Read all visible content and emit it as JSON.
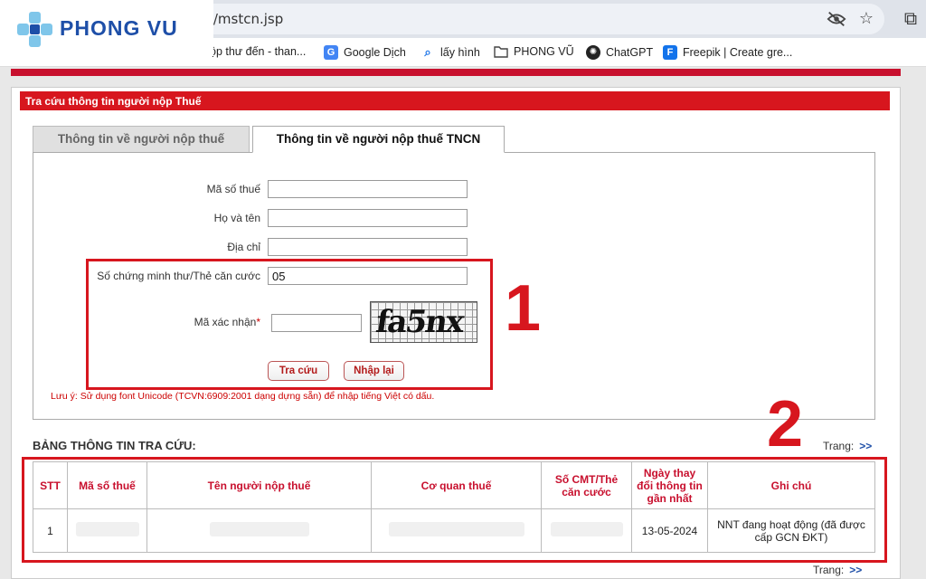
{
  "browser": {
    "url": "t/mstcn.jsp",
    "bookmarks": [
      {
        "label": "ộp thư đến - than...",
        "icon": "mail-icon"
      },
      {
        "label": "Google Dịch",
        "icon": "translate-icon"
      },
      {
        "label": "lấy hình",
        "icon": "search-icon"
      },
      {
        "label": "PHONG VŨ",
        "icon": "folder-icon"
      },
      {
        "label": "ChatGPT",
        "icon": "chatgpt-icon"
      },
      {
        "label": "Freepik | Create gre...",
        "icon": "freepik-icon"
      }
    ]
  },
  "logo": {
    "text": "PHONG VU"
  },
  "panel": {
    "header": "Tra cứu thông tin người nộp Thuế"
  },
  "tabs": [
    {
      "label": "Thông tin về người nộp thuế",
      "active": false
    },
    {
      "label": "Thông tin về người nộp thuế TNCN",
      "active": true
    }
  ],
  "form": {
    "tax_code_label": "Mã số thuế",
    "tax_code_value": "",
    "name_label": "Họ và tên",
    "name_value": "",
    "address_label": "Địa chỉ",
    "address_value": "",
    "id_label": "Số chứng minh thư/Thẻ căn cước",
    "id_value": "05",
    "captcha_label": "Mã xác nhận",
    "captcha_required_mark": "*",
    "captcha_value": "",
    "captcha_image_text": "fa5nx",
    "search_button": "Tra cứu",
    "reset_button": "Nhập lại",
    "note": "Lưu ý: Sử dụng font Unicode (TCVN:6909:2001 dạng dựng sẵn) để nhập tiếng Việt có dấu."
  },
  "annotations": {
    "one": "1",
    "two": "2"
  },
  "results": {
    "title": "BẢNG THÔNG TIN TRA CỨU:",
    "pager_label": "Trang:",
    "pager_arrow": ">>",
    "columns": [
      "STT",
      "Mã số thuế",
      "Tên người nộp thuế",
      "Cơ quan thuế",
      "Số CMT/Thẻ căn cước",
      "Ngày thay đổi thông tin gần nhất",
      "Ghi chú"
    ],
    "rows": [
      {
        "stt": "1",
        "tax_code": "",
        "name": "",
        "tax_office": "",
        "id_number": "",
        "date": "13-05-2024",
        "note": "NNT đang hoạt động (đã được cấp GCN ĐKT)"
      }
    ]
  },
  "colors": {
    "accent_red": "#d7161e",
    "brand_blue": "#1e4fa8"
  }
}
